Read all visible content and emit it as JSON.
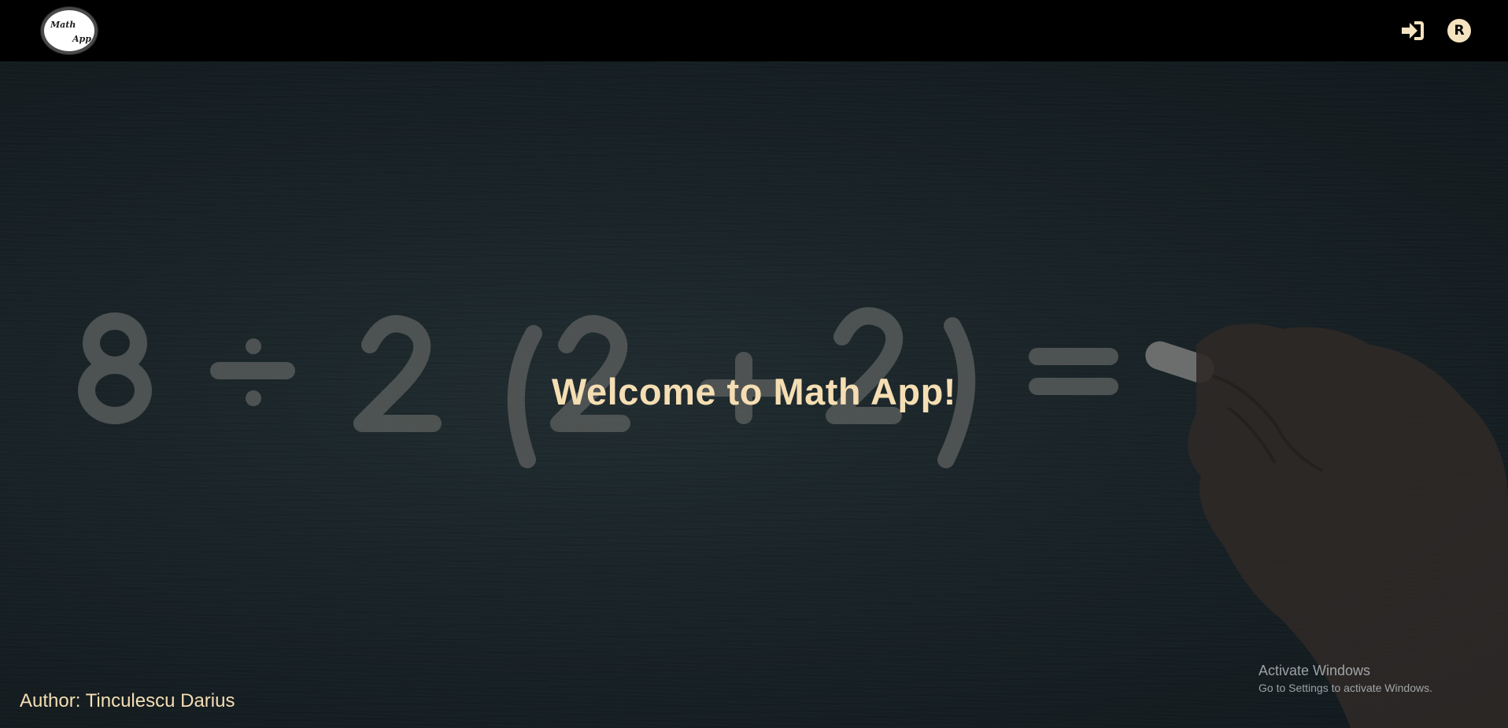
{
  "navbar": {
    "logo": {
      "line1": "Math",
      "line2": "App",
      "icon": "math-app-logo"
    },
    "login_icon": "sign-in-icon",
    "register_icon": {
      "name": "register-icon",
      "letter": "R"
    }
  },
  "hero": {
    "background_equation": "8 ÷ 2 (2 + 2) =",
    "title": "Welcome to Math App!"
  },
  "footer": {
    "author": "Author: Tinculescu Darius"
  },
  "watermark": {
    "title": "Activate Windows",
    "subtitle": "Go to Settings to activate Windows."
  },
  "colors": {
    "navbar_bg": "#000000",
    "accent": "#f5deb3",
    "chalkboard": "#1f2b30"
  }
}
